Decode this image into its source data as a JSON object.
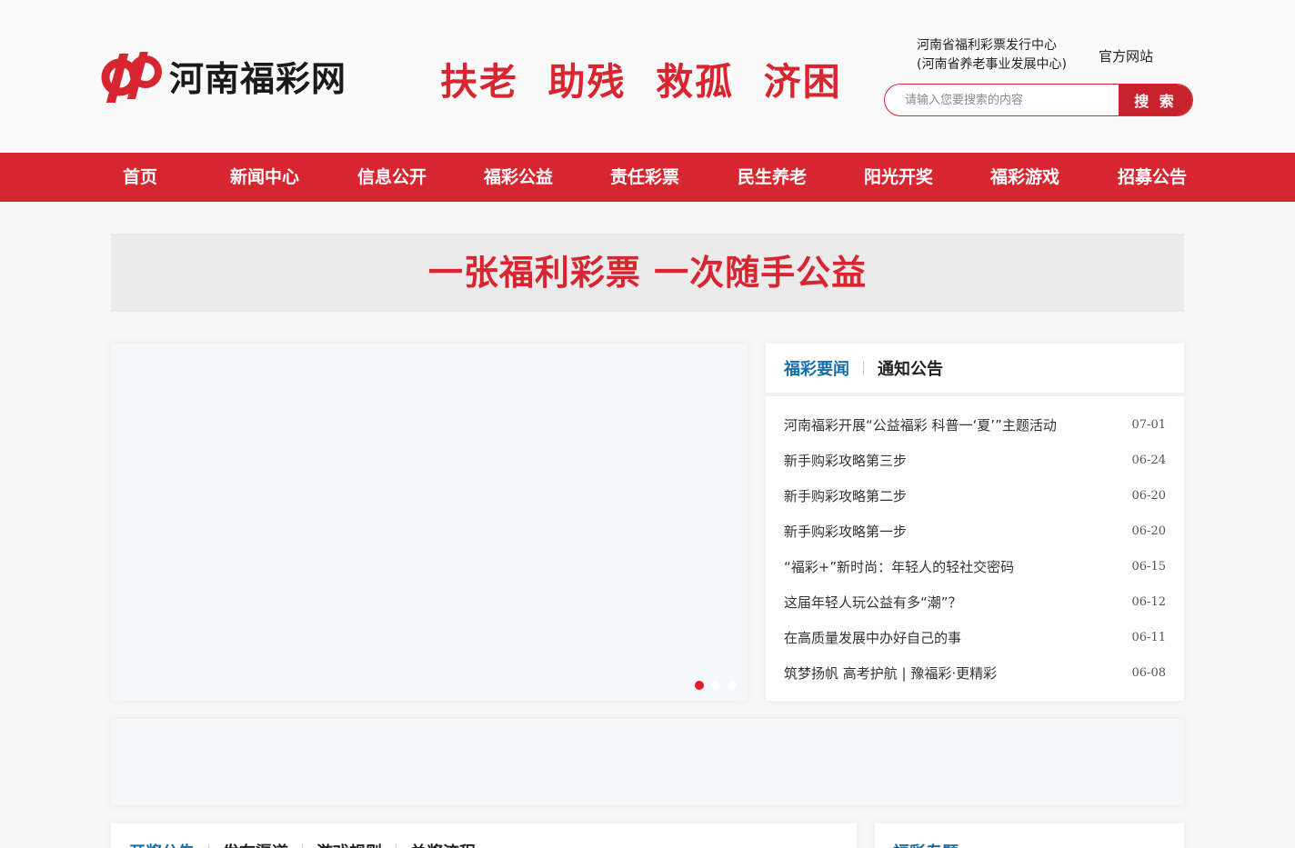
{
  "header": {
    "logo_text": "河南福彩网",
    "slogan": "扶老  助残  救孤  济困",
    "org_line1": "河南省福利彩票发行中心",
    "org_line2": "(河南省养老事业发展中心)",
    "official_site": "官方网站",
    "search_placeholder": "请输入您要搜索的内容",
    "search_button": "搜 索"
  },
  "nav": {
    "items": [
      "首页",
      "新闻中心",
      "信息公开",
      "福彩公益",
      "责任彩票",
      "民生养老",
      "阳光开奖",
      "福彩游戏",
      "招募公告"
    ]
  },
  "banner": {
    "text": "一张福利彩票 一次随手公益"
  },
  "news": {
    "tabs": [
      "福彩要闻",
      "通知公告"
    ],
    "items": [
      {
        "title": "河南福彩开展“公益福彩 科普一‘夏’”主题活动",
        "date": "07-01"
      },
      {
        "title": "新手购彩攻略第三步",
        "date": "06-24"
      },
      {
        "title": "新手购彩攻略第二步",
        "date": "06-20"
      },
      {
        "title": "新手购彩攻略第一步",
        "date": "06-20"
      },
      {
        "title": "“福彩+”新时尚：年轻人的轻社交密码",
        "date": "06-15"
      },
      {
        "title": "这届年轻人玩公益有多“潮”？",
        "date": "06-12"
      },
      {
        "title": "在高质量发展中办好自己的事",
        "date": "06-11"
      },
      {
        "title": "筑梦扬帆 高考护航 | 豫福彩·更精彩",
        "date": "06-08"
      }
    ]
  },
  "lower": {
    "left_tabs": [
      "开奖公告",
      "发布渠道",
      "游戏规则",
      "兑奖流程"
    ],
    "right_tabs": [
      "福彩专题"
    ]
  },
  "colors": {
    "brand_red": "#d7262f",
    "tab_blue": "#1a6ea8"
  }
}
